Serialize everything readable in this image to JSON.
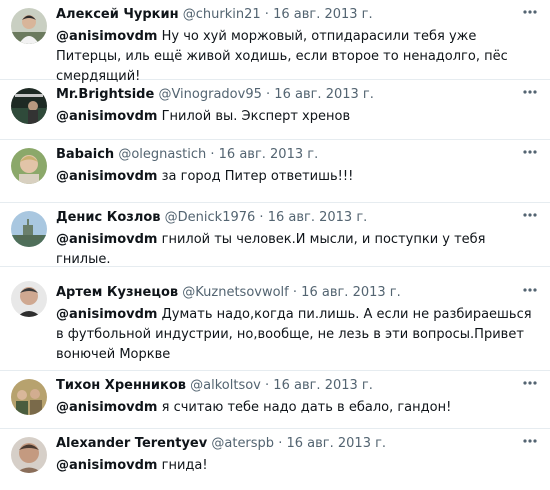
{
  "tweets": [
    {
      "name": "Алексей Чуркин",
      "handle": "@churkin21",
      "separator": "·",
      "date": "16 авг. 2013 г.",
      "mention": "@anisimovdm",
      "text": " Ну чо хуй моржовый, отпидарасили тебя уже Питерцы, иль ещё живой ходишь, если второе то ненадолго, пёс смердящий!",
      "avatar_icon": "avatar-man-photo",
      "avatar_color": "#6b7a5e"
    },
    {
      "name": "Mr.Brightside",
      "handle": "@Vinogradov95",
      "separator": "·",
      "date": "16 авг. 2013 г.",
      "mention": "@anisimovdm",
      "text": " Гнилой вы. Эксперт хренов",
      "avatar_icon": "avatar-stadium-photo",
      "avatar_color": "#2f4a3a"
    },
    {
      "name": "Babaich",
      "handle": "@olegnastich",
      "separator": "·",
      "date": "16 авг. 2013 г.",
      "mention": "@anisimovdm",
      "text": " за город Питер ответишь!!!",
      "avatar_icon": "avatar-child-photo",
      "avatar_color": "#8ba86a"
    },
    {
      "name": "Денис Козлов",
      "handle": "@Denick1976",
      "separator": "·",
      "date": "16 авг. 2013 г.",
      "mention": "@anisimovdm",
      "text": " гнилой ты человек.И мысли, и поступки у тебя гнилые.",
      "avatar_icon": "avatar-ship-photo",
      "avatar_color": "#7fa7c9"
    },
    {
      "name": "Артем Кузнецов",
      "handle": "@Kuznetsovwolf",
      "separator": "·",
      "date": "16 авг. 2013 г.",
      "mention": "@anisimovdm",
      "text": " Думать надо,когда пи.лишь. А если не разбираешься в футбольной индустрии, но,вообще, не лезь в эти вопросы.Привет вонючей Моркве",
      "avatar_icon": "avatar-man-photo",
      "avatar_color": "#5a5a5a"
    },
    {
      "name": "Тихон Хренников",
      "handle": "@alkoltsov",
      "separator": "·",
      "date": "16 авг. 2013 г.",
      "mention": "@anisimovdm",
      "text": " я считаю тебе надо дать в ебало, гандон!",
      "avatar_icon": "avatar-group-photo",
      "avatar_color": "#9c8a5c"
    },
    {
      "name": "Alexander Terentyev",
      "handle": "@aterspb",
      "separator": "·",
      "date": "16 авг. 2013 г.",
      "mention": "@anisimovdm",
      "text": " гнида!",
      "avatar_icon": "avatar-man-photo",
      "avatar_color": "#8a6e5a"
    }
  ]
}
